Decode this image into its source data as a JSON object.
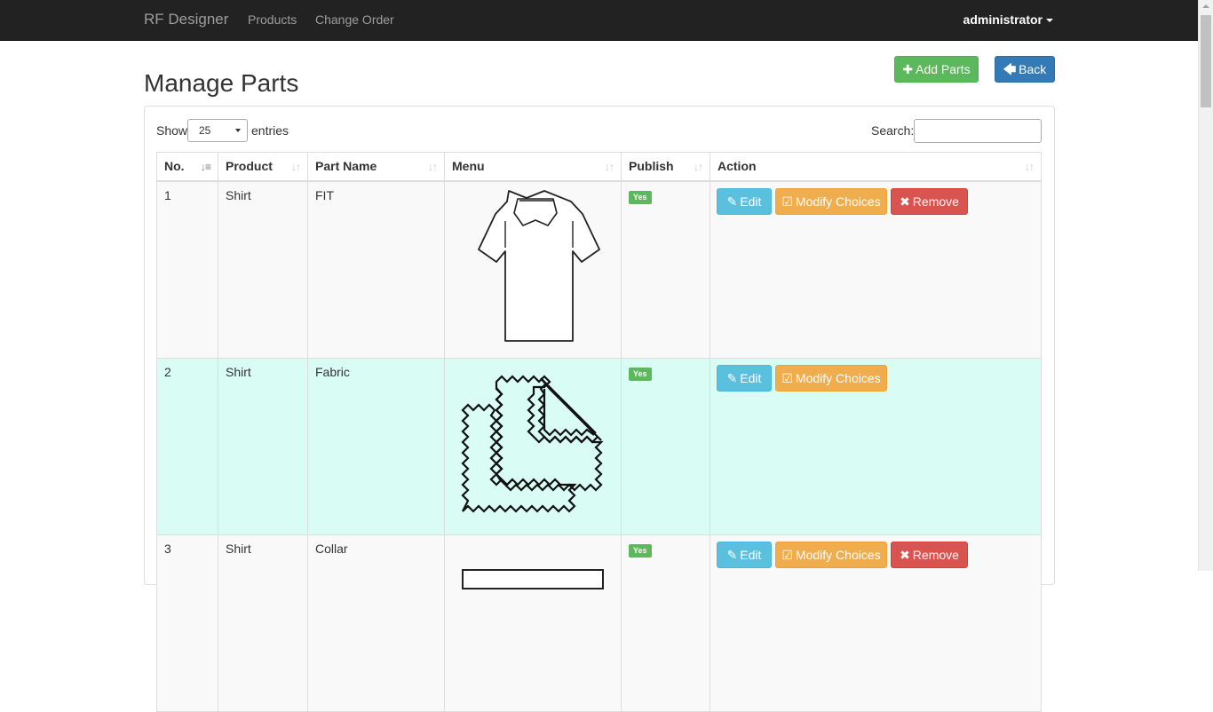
{
  "navbar": {
    "brand": "RF Designer",
    "links": [
      "Products",
      "Change Order"
    ],
    "user": "administrator"
  },
  "page": {
    "title": "Manage Parts",
    "add_button": "Add Parts",
    "back_button": "Back"
  },
  "table_controls": {
    "show_label": "Show",
    "entries_value": "25",
    "entries_label": "entries",
    "search_label": "Search:",
    "search_value": ""
  },
  "table": {
    "columns": [
      "No.",
      "Product",
      "Part Name",
      "Menu",
      "Publish",
      "Action"
    ],
    "rows": [
      {
        "no": "1",
        "product": "Shirt",
        "part_name": "FIT",
        "menu_icon": "shirt-icon",
        "publish": "Yes",
        "actions": [
          "Edit",
          "Modify Choices",
          "Remove"
        ]
      },
      {
        "no": "2",
        "product": "Shirt",
        "part_name": "Fabric",
        "menu_icon": "fabric-swatches-icon",
        "publish": "Yes",
        "actions": [
          "Edit",
          "Modify Choices"
        ]
      },
      {
        "no": "3",
        "product": "Shirt",
        "part_name": "Collar",
        "menu_icon": "collar-icon",
        "publish": "Yes",
        "actions": [
          "Edit",
          "Modify Choices",
          "Remove"
        ]
      }
    ]
  },
  "colors": {
    "navbar_bg": "#222222",
    "success": "#5cb85c",
    "primary": "#337ab7",
    "info": "#5bc0de",
    "warning": "#f0ad4e",
    "danger": "#d9534f",
    "highlight_row": "#d9fcf4"
  }
}
